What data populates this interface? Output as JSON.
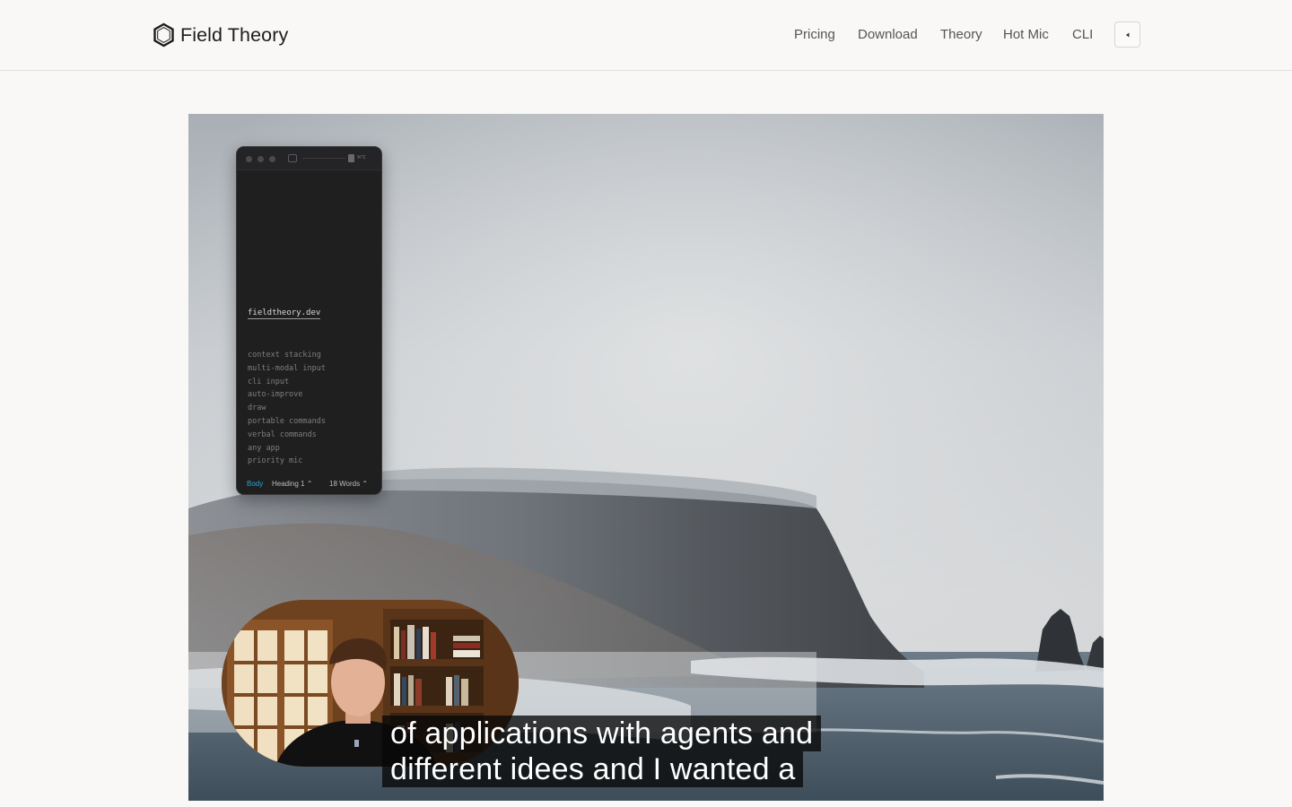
{
  "header": {
    "brand_name": "Field Theory",
    "nav": [
      {
        "label": "Pricing"
      },
      {
        "label": "Download"
      },
      {
        "label": "Theory"
      },
      {
        "label": "Hot Mic"
      },
      {
        "label": "CLI"
      }
    ],
    "theme_toggle_icon": "chevron-left-icon"
  },
  "video": {
    "app_window": {
      "title_shortcut": "⌘⌥",
      "heading": "fieldtheory.dev",
      "items": [
        "context stacking",
        "multi-modal input",
        "cli input",
        "auto-improve",
        "draw",
        "portable commands",
        "verbal commands",
        "any app",
        "priority mic"
      ],
      "status": {
        "style": "Body",
        "heading": "Heading 1 ⌃",
        "words": "18 Words ⌃"
      }
    },
    "captions": [
      "of applications with agents and",
      "different idees and I wanted a"
    ]
  },
  "colors": {
    "page_bg": "#f9f8f6",
    "accent_body": "#2aa3cf",
    "caption_bg": "#141414"
  }
}
